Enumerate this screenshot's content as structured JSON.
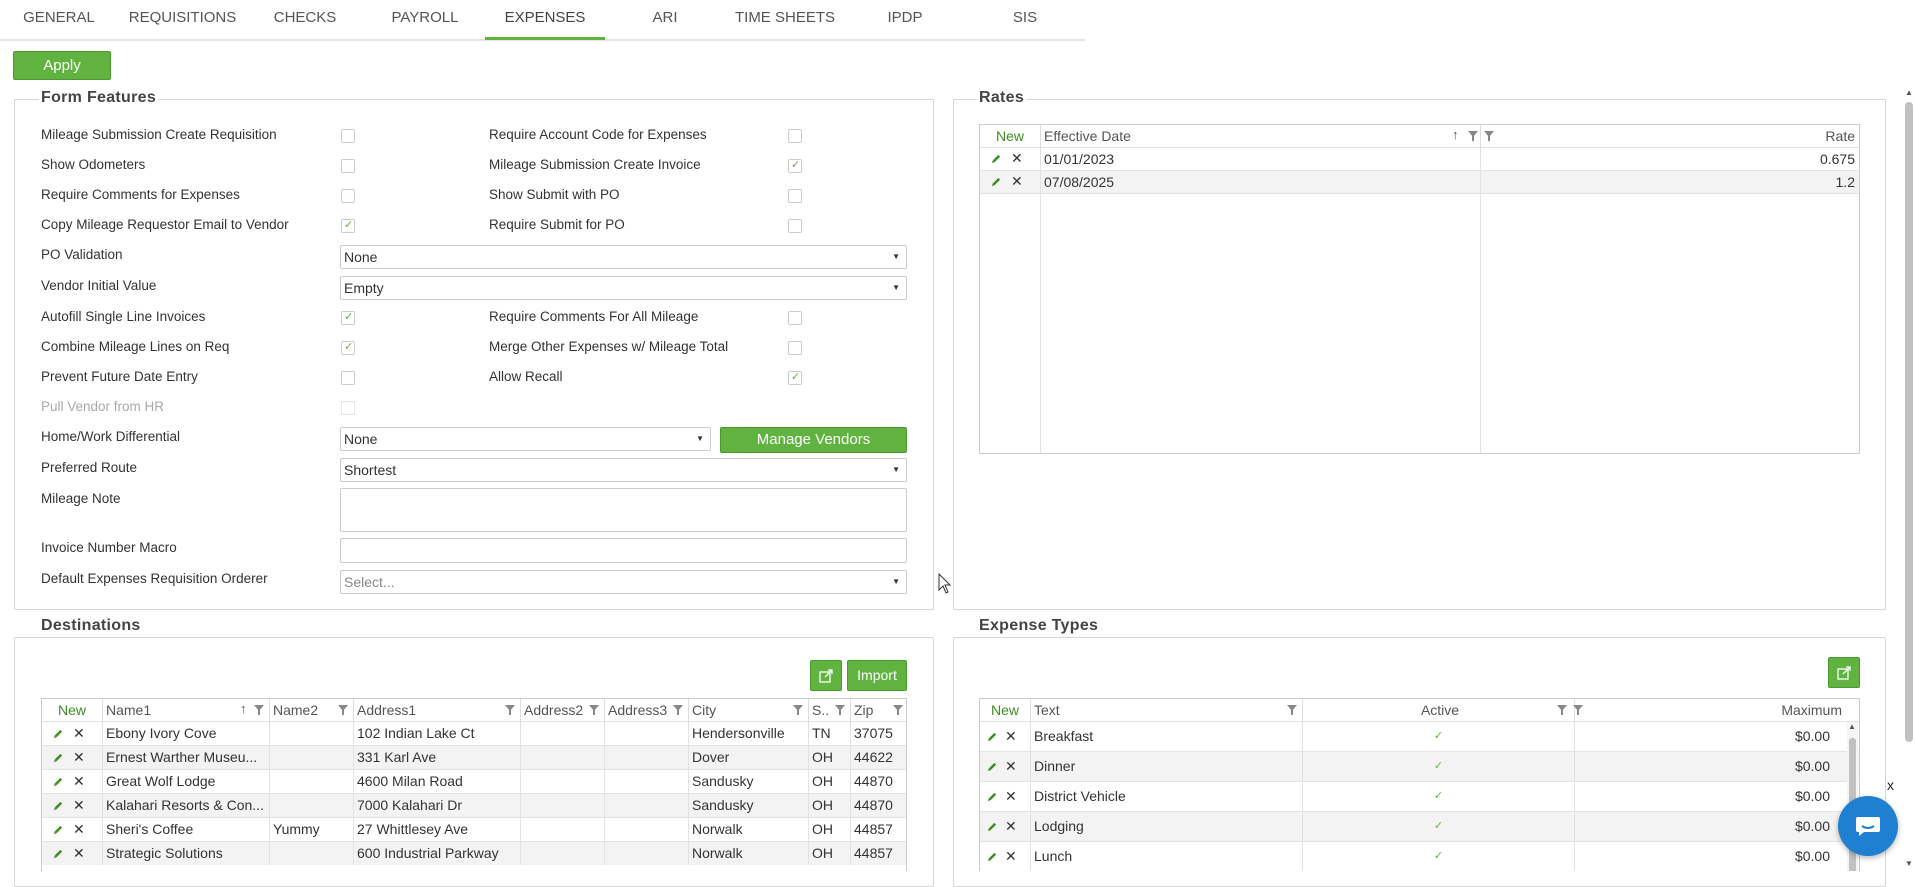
{
  "tabs": [
    "GENERAL",
    "REQUISITIONS",
    "CHECKS",
    "PAYROLL",
    "EXPENSES",
    "ARI",
    "TIME SHEETS",
    "IPDP",
    "SIS"
  ],
  "active_tab": "EXPENSES",
  "apply_label": "Apply",
  "form_features": {
    "title": "Form Features",
    "rows": [
      {
        "label": "Mileage Submission Create Requisition",
        "checked": false,
        "right_label": "Require Account Code for Expenses",
        "right_checked": false
      },
      {
        "label": "Show Odometers",
        "checked": false,
        "right_label": "Mileage Submission Create Invoice",
        "right_checked": true
      },
      {
        "label": "Require Comments for Expenses",
        "checked": false,
        "right_label": "Show Submit with PO",
        "right_checked": false
      },
      {
        "label": "Copy Mileage Requestor Email to Vendor",
        "checked": true,
        "right_label": "Require Submit for PO",
        "right_checked": false
      }
    ],
    "po_validation": {
      "label": "PO Validation",
      "value": "None"
    },
    "vendor_initial": {
      "label": "Vendor Initial Value",
      "value": "Empty"
    },
    "rows2": [
      {
        "label": "Autofill Single Line Invoices",
        "checked": true,
        "right_label": "Require Comments For All Mileage",
        "right_checked": false
      },
      {
        "label": "Combine Mileage Lines on Req",
        "checked": true,
        "right_label": "Merge Other Expenses w/ Mileage Total",
        "right_checked": false
      },
      {
        "label": "Prevent Future Date Entry",
        "checked": false,
        "right_label": "Allow Recall",
        "right_checked": true
      }
    ],
    "pull_vendor": {
      "label": "Pull Vendor from HR",
      "checked": false,
      "disabled": true
    },
    "home_work": {
      "label": "Home/Work Differential",
      "value": "None"
    },
    "manage_vendors_label": "Manage Vendors",
    "preferred_route": {
      "label": "Preferred Route",
      "value": "Shortest"
    },
    "mileage_note": {
      "label": "Mileage Note",
      "value": ""
    },
    "invoice_macro": {
      "label": "Invoice Number Macro",
      "value": ""
    },
    "default_orderer": {
      "label": "Default Expenses Requisition Orderer",
      "placeholder": "Select..."
    }
  },
  "rates": {
    "title": "Rates",
    "new_label": "New",
    "headers": [
      "Effective Date",
      "Rate"
    ],
    "rows": [
      {
        "date": "01/01/2023",
        "rate": "0.675"
      },
      {
        "date": "07/08/2025",
        "rate": "1.2"
      }
    ]
  },
  "destinations": {
    "title": "Destinations",
    "import_label": "Import",
    "new_label": "New",
    "headers": [
      "Name1",
      "Name2",
      "Address1",
      "Address2",
      "Address3",
      "City",
      "S..",
      "Zip"
    ],
    "rows": [
      {
        "name1": "Ebony Ivory Cove",
        "name2": "",
        "address1": "102 Indian Lake Ct",
        "address2": "",
        "address3": "",
        "city": "Hendersonville",
        "state": "TN",
        "zip": "37075"
      },
      {
        "name1": "Ernest Warther Museu...",
        "name2": "",
        "address1": "331 Karl Ave",
        "address2": "",
        "address3": "",
        "city": "Dover",
        "state": "OH",
        "zip": "44622"
      },
      {
        "name1": "Great Wolf Lodge",
        "name2": "",
        "address1": "4600 Milan Road",
        "address2": "",
        "address3": "",
        "city": "Sandusky",
        "state": "OH",
        "zip": "44870"
      },
      {
        "name1": "Kalahari Resorts & Con...",
        "name2": "",
        "address1": "7000 Kalahari Dr",
        "address2": "",
        "address3": "",
        "city": "Sandusky",
        "state": "OH",
        "zip": "44870"
      },
      {
        "name1": "Sheri's Coffee",
        "name2": "Yummy",
        "address1": "27 Whittlesey Ave",
        "address2": "",
        "address3": "",
        "city": "Norwalk",
        "state": "OH",
        "zip": "44857"
      },
      {
        "name1": "Strategic Solutions",
        "name2": "",
        "address1": "600 Industrial Parkway",
        "address2": "",
        "address3": "",
        "city": "Norwalk",
        "state": "OH",
        "zip": "44857"
      }
    ]
  },
  "expense_types": {
    "title": "Expense Types",
    "new_label": "New",
    "headers": [
      "Text",
      "Active",
      "Maximum"
    ],
    "rows": [
      {
        "text": "Breakfast",
        "active": true,
        "maximum": "$0.00"
      },
      {
        "text": "Dinner",
        "active": true,
        "maximum": "$0.00"
      },
      {
        "text": "District Vehicle",
        "active": true,
        "maximum": "$0.00"
      },
      {
        "text": "Lodging",
        "active": true,
        "maximum": "$0.00"
      },
      {
        "text": "Lunch",
        "active": true,
        "maximum": "$0.00"
      }
    ]
  },
  "chat_close_label": "x",
  "check_mark": "✓",
  "accent_color": "#5fb33e"
}
